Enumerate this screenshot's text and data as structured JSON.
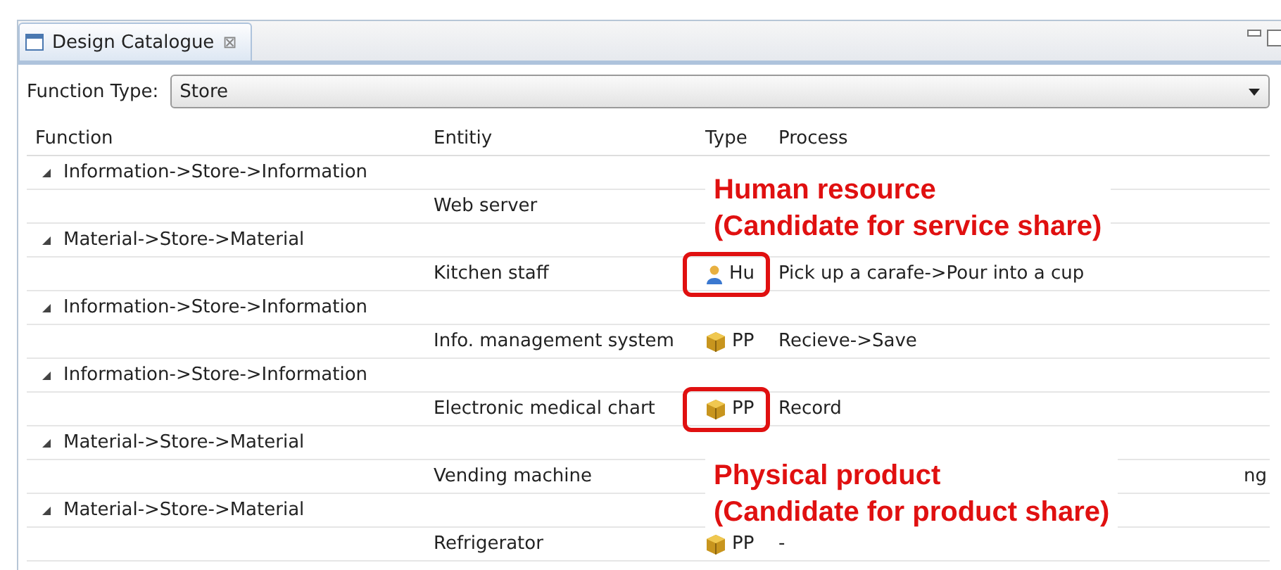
{
  "window": {
    "tab_title": "Design Catalogue",
    "tab_close": "⊠"
  },
  "filter": {
    "label": "Function Type:",
    "value": "Store"
  },
  "table": {
    "columns": [
      "Function",
      "Entitiy",
      "Type",
      "Process"
    ],
    "groups": [
      {
        "function": "Information->Store->Information",
        "expanded": true,
        "children": [
          {
            "entity": "Web server",
            "highlighted": false
          }
        ]
      },
      {
        "function": "Material->Store->Material",
        "expanded": true,
        "children": [
          {
            "entity": "Kitchen staff",
            "type": "Hu",
            "kind": "person",
            "process": "Pick up a carafe->Pour into a cup",
            "highlighted": true
          }
        ]
      },
      {
        "function": "Information->Store->Information",
        "expanded": true,
        "children": [
          {
            "entity": "Info. management system",
            "type": "PP",
            "kind": "product",
            "process": "Recieve->Save",
            "highlighted": false
          }
        ]
      },
      {
        "function": "Information->Store->Information",
        "expanded": true,
        "children": [
          {
            "entity": "Electronic medical chart",
            "type": "PP",
            "kind": "product",
            "process": "Record",
            "highlighted": true
          }
        ]
      },
      {
        "function": "Material->Store->Material",
        "expanded": true,
        "children": [
          {
            "entity": "Vending machine",
            "process_tail": "ng",
            "highlighted": false
          }
        ]
      },
      {
        "function": "Material->Store->Material",
        "expanded": true,
        "children": [
          {
            "entity": "Refrigerator",
            "type": "PP",
            "kind": "product",
            "process": "-",
            "highlighted": false
          }
        ]
      }
    ]
  },
  "annotations": [
    {
      "lines": [
        "Human resource",
        "(Candidate for service share)"
      ]
    },
    {
      "lines": [
        "Physical product",
        "(Candidate for product share)"
      ]
    }
  ]
}
